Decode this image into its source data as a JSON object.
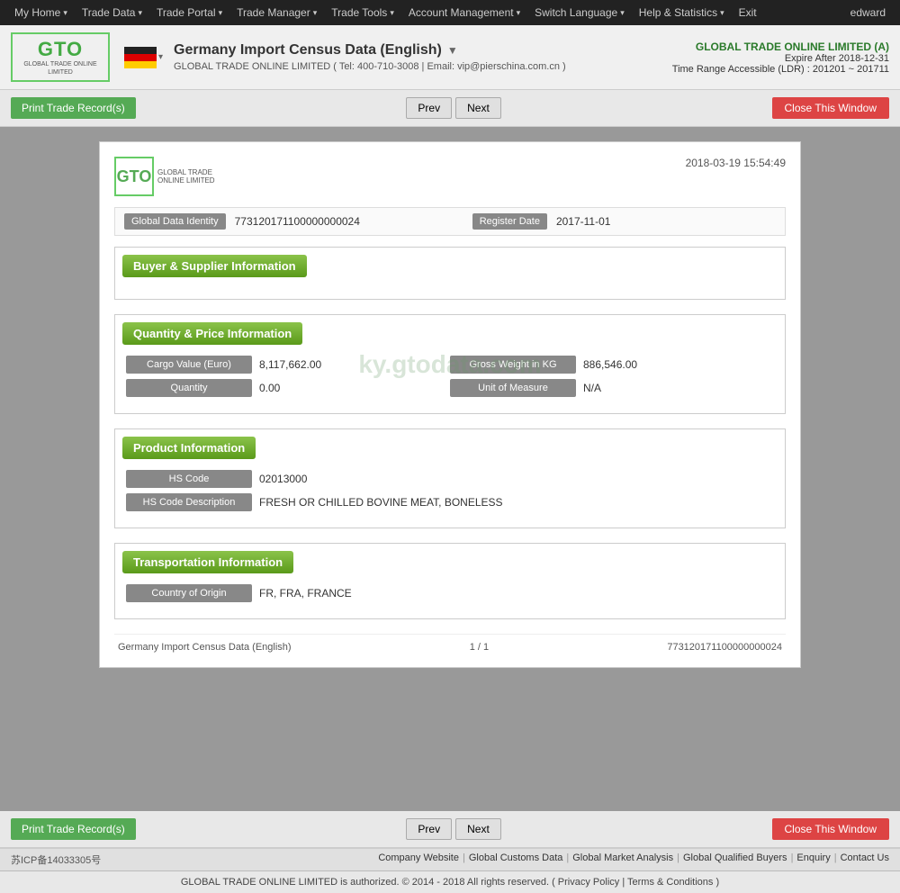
{
  "topnav": {
    "items": [
      {
        "label": "My Home",
        "arrow": true
      },
      {
        "label": "Trade Data",
        "arrow": true
      },
      {
        "label": "Trade Portal",
        "arrow": true
      },
      {
        "label": "Trade Manager",
        "arrow": true
      },
      {
        "label": "Trade Tools",
        "arrow": true
      },
      {
        "label": "Account Management",
        "arrow": true
      },
      {
        "label": "Switch Language",
        "arrow": true
      },
      {
        "label": "Help & Statistics",
        "arrow": true
      },
      {
        "label": "Exit",
        "arrow": false
      }
    ],
    "user": "edward"
  },
  "header": {
    "logo_text": "GTO",
    "logo_subtitle": "GLOBAL TRADE ONLINE LIMITED",
    "flag_country": "Germany",
    "title": "Germany Import Census Data (English)",
    "title_arrow": "▼",
    "subtitle": "GLOBAL TRADE ONLINE LIMITED ( Tel: 400-710-3008 | Email: vip@pierschina.com.cn )",
    "company_name": "GLOBAL TRADE ONLINE LIMITED (A)",
    "expire": "Expire After 2018-12-31",
    "time_range": "Time Range Accessible (LDR) : 201201 ~ 201711"
  },
  "actions": {
    "print_label": "Print Trade Record(s)",
    "prev_label": "Prev",
    "next_label": "Next",
    "close_label": "Close This Window"
  },
  "record": {
    "timestamp": "2018-03-19 15:54:49",
    "global_data_identity_label": "Global Data Identity",
    "global_data_identity_value": "773120171100000000024",
    "register_date_label": "Register Date",
    "register_date_value": "2017-11-01",
    "sections": {
      "buyer_supplier": {
        "title": "Buyer & Supplier Information"
      },
      "quantity_price": {
        "title": "Quantity & Price Information",
        "fields": [
          {
            "label": "Cargo Value (Euro)",
            "value": "8,117,662.00",
            "label2": "Gross Weight in KG",
            "value2": "886,546.00"
          },
          {
            "label": "Quantity",
            "value": "0.00",
            "label2": "Unit of Measure",
            "value2": "N/A"
          }
        ]
      },
      "product": {
        "title": "Product Information",
        "fields": [
          {
            "label": "HS Code",
            "value": "02013000"
          },
          {
            "label": "HS Code Description",
            "value": "FRESH OR CHILLED BOVINE MEAT, BONELESS"
          }
        ]
      },
      "transportation": {
        "title": "Transportation Information",
        "fields": [
          {
            "label": "Country of Origin",
            "value": "FR, FRA, FRANCE"
          }
        ]
      }
    },
    "footer": {
      "left": "Germany Import Census Data (English)",
      "center": "1 / 1",
      "right": "773120171100000000024"
    },
    "watermark": "ky.gtodata.com"
  },
  "footer": {
    "links": [
      "Company Website",
      "Global Customs Data",
      "Global Market Analysis",
      "Global Qualified Buyers",
      "Enquiry",
      "Contact Us"
    ],
    "icp": "苏ICP备14033305号",
    "copyright": "GLOBAL TRADE ONLINE LIMITED is authorized. © 2014 - 2018 All rights reserved.  ( Privacy Policy | Terms & Conditions )"
  }
}
